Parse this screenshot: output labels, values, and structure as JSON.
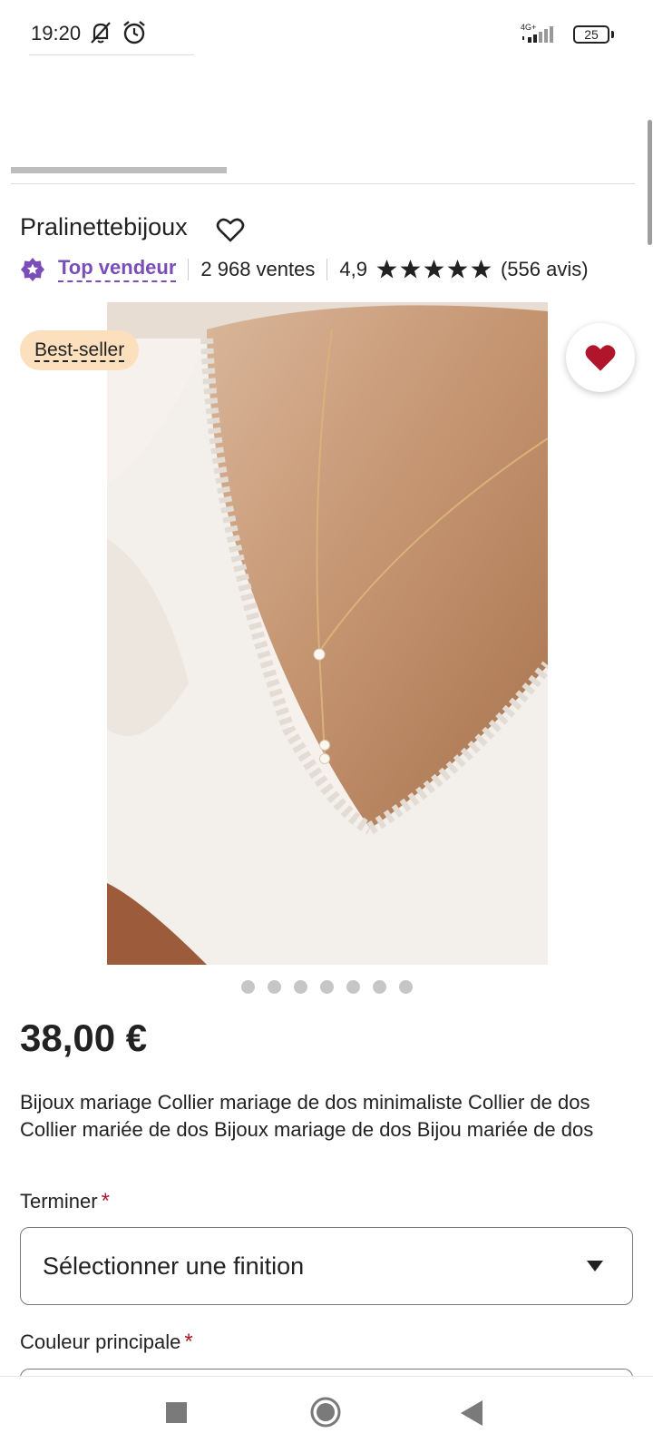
{
  "status_bar": {
    "time": "19:20",
    "network": "4G+",
    "battery": "25",
    "icons": [
      "mute-icon",
      "alarm-icon",
      "signal-icon",
      "battery-icon"
    ]
  },
  "shop": {
    "name": "Pralinettebijoux",
    "badge_label": "Top vendeur",
    "sales": "2 968 ventes",
    "rating": "4,9",
    "stars": 5,
    "reviews": "(556 avis)"
  },
  "product": {
    "badge": "Best-seller",
    "image_count": 7,
    "price": "38,00 €",
    "title": "Bijoux mariage Collier mariage de dos minimaliste Collier de dos Collier mariée de dos Bijoux mariage de dos Bijou mariée de dos"
  },
  "options": {
    "finish_label": "Terminer",
    "finish_placeholder": "Sélectionner une finition",
    "color_label": "Couleur principale",
    "required_mark": "*"
  },
  "colors": {
    "accent_purple": "#7a4db8",
    "favorite_red": "#b0152c",
    "badge_peach": "#fcdfbd",
    "required_red": "#a61a2e"
  }
}
